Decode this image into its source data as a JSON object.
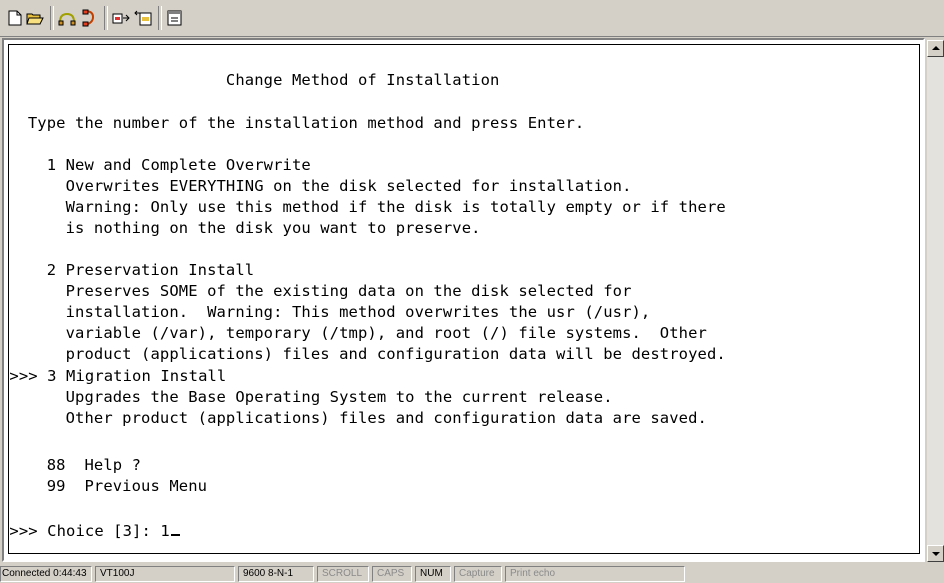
{
  "toolbar": {
    "buttons": [
      "new-session-icon",
      "open-session-icon",
      "connect-icon",
      "disconnect-icon",
      "send-file-icon",
      "receive-file-icon",
      "properties-icon"
    ]
  },
  "terminal": {
    "lines": [
      "                       Change Method of Installation",
      "",
      "  Type the number of the installation method and press Enter.",
      "",
      "    1 New and Complete Overwrite",
      "      Overwrites EVERYTHING on the disk selected for installation.",
      "      Warning: Only use this method if the disk is totally empty or if there",
      "      is nothing on the disk you want to preserve.",
      "",
      "    2 Preservation Install",
      "      Preserves SOME of the existing data on the disk selected for",
      "      installation.  Warning: This method overwrites the usr (/usr),",
      "      variable (/var), temporary (/tmp), and root (/) file systems.  Other",
      "      product (applications) files and configuration data will be destroyed.",
      "",
      " >>> 3 Migration Install",
      "      Upgrades the Base Operating System to the current release.",
      "      Other product (applications) files and configuration data are saved.",
      "",
      "",
      "    88  Help ?",
      "    99  Previous Menu",
      "",
      " >>> Choice [3]: 1"
    ]
  },
  "statusbar": {
    "connected": "Connected 0:44:43",
    "emulation": "VT100J",
    "port_settings": "9600 8-N-1",
    "scroll": "SCROLL",
    "caps": "CAPS",
    "num": "NUM",
    "capture": "Capture",
    "print_echo": "Print echo"
  },
  "colors": {
    "chrome": "#d4d0c8",
    "terminal_bg": "#ffffff",
    "terminal_text": "#000000"
  }
}
